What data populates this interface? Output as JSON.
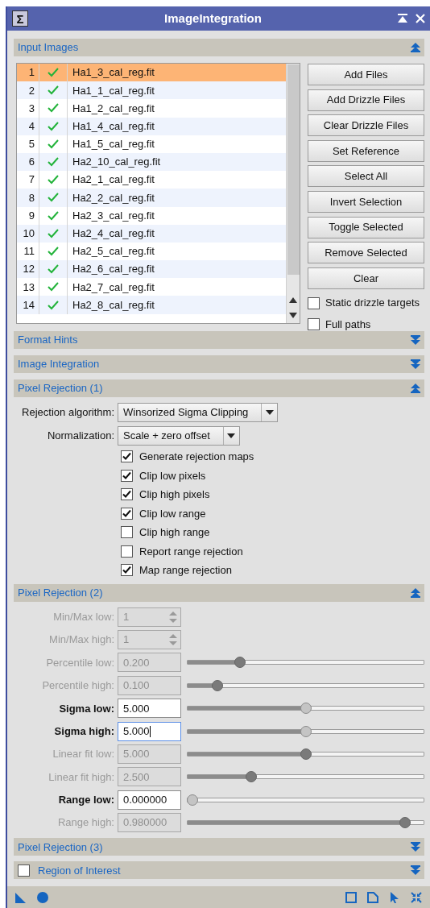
{
  "window": {
    "icon_glyph": "Σ",
    "title": "ImageIntegration"
  },
  "input_images": {
    "header": {
      "label": "Input Images",
      "expanded": true
    },
    "rows": [
      {
        "index": "1",
        "enabled": true,
        "name": "Ha1_3_cal_reg.fit",
        "selected": true
      },
      {
        "index": "2",
        "enabled": true,
        "name": "Ha1_1_cal_reg.fit",
        "selected": false
      },
      {
        "index": "3",
        "enabled": true,
        "name": "Ha1_2_cal_reg.fit",
        "selected": false
      },
      {
        "index": "4",
        "enabled": true,
        "name": "Ha1_4_cal_reg.fit",
        "selected": false
      },
      {
        "index": "5",
        "enabled": true,
        "name": "Ha1_5_cal_reg.fit",
        "selected": false
      },
      {
        "index": "6",
        "enabled": true,
        "name": "Ha2_10_cal_reg.fit",
        "selected": false
      },
      {
        "index": "7",
        "enabled": true,
        "name": "Ha2_1_cal_reg.fit",
        "selected": false
      },
      {
        "index": "8",
        "enabled": true,
        "name": "Ha2_2_cal_reg.fit",
        "selected": false
      },
      {
        "index": "9",
        "enabled": true,
        "name": "Ha2_3_cal_reg.fit",
        "selected": false
      },
      {
        "index": "10",
        "enabled": true,
        "name": "Ha2_4_cal_reg.fit",
        "selected": false
      },
      {
        "index": "11",
        "enabled": true,
        "name": "Ha2_5_cal_reg.fit",
        "selected": false
      },
      {
        "index": "12",
        "enabled": true,
        "name": "Ha2_6_cal_reg.fit",
        "selected": false
      },
      {
        "index": "13",
        "enabled": true,
        "name": "Ha2_7_cal_reg.fit",
        "selected": false
      },
      {
        "index": "14",
        "enabled": true,
        "name": "Ha2_8_cal_reg.fit",
        "selected": false
      }
    ],
    "buttons": [
      "Add Files",
      "Add Drizzle Files",
      "Clear Drizzle Files",
      "Set Reference",
      "Select All",
      "Invert Selection",
      "Toggle Selected",
      "Remove Selected",
      "Clear"
    ],
    "options": [
      {
        "label": "Static drizzle targets",
        "checked": false
      },
      {
        "label": "Full paths",
        "checked": false
      }
    ]
  },
  "format_hints": {
    "label": "Format Hints",
    "expanded": false
  },
  "image_integration": {
    "label": "Image Integration",
    "expanded": false
  },
  "pixel_rejection_1": {
    "label": "Pixel Rejection (1)",
    "expanded": true,
    "combos": [
      {
        "label": "Rejection algorithm:",
        "value": "Winsorized Sigma Clipping"
      },
      {
        "label": "Normalization:",
        "value": "Scale + zero offset"
      }
    ],
    "checkboxes": [
      {
        "label": "Generate rejection maps",
        "checked": true
      },
      {
        "label": "Clip low pixels",
        "checked": true
      },
      {
        "label": "Clip high pixels",
        "checked": true
      },
      {
        "label": "Clip low range",
        "checked": true
      },
      {
        "label": "Clip high range",
        "checked": false
      },
      {
        "label": "Report range rejection",
        "checked": false
      },
      {
        "label": "Map range rejection",
        "checked": true
      }
    ]
  },
  "pixel_rejection_2": {
    "label": "Pixel Rejection (2)",
    "expanded": true,
    "rows": [
      {
        "kind": "spin",
        "label": "Min/Max low:",
        "value": "1",
        "disabled": true,
        "focused": false
      },
      {
        "kind": "spin",
        "label": "Min/Max high:",
        "value": "1",
        "disabled": true,
        "focused": false
      },
      {
        "kind": "slider",
        "label": "Percentile low:",
        "value": "0.200",
        "disabled": true,
        "focused": false,
        "level": 0.21
      },
      {
        "kind": "slider",
        "label": "Percentile high:",
        "value": "0.100",
        "disabled": true,
        "focused": false,
        "level": 0.11
      },
      {
        "kind": "slider",
        "label": "Sigma low:",
        "value": "5.000",
        "disabled": false,
        "focused": false,
        "level": 0.5
      },
      {
        "kind": "slider",
        "label": "Sigma high:",
        "value": "5.000",
        "disabled": false,
        "focused": true,
        "level": 0.5
      },
      {
        "kind": "slider",
        "label": "Linear fit low:",
        "value": "5.000",
        "disabled": true,
        "focused": false,
        "level": 0.5
      },
      {
        "kind": "slider",
        "label": "Linear fit high:",
        "value": "2.500",
        "disabled": true,
        "focused": false,
        "level": 0.26
      },
      {
        "kind": "slider",
        "label": "Range low:",
        "value": "0.000000",
        "disabled": false,
        "focused": false,
        "level": 0.0
      },
      {
        "kind": "slider",
        "label": "Range high:",
        "value": "0.980000",
        "disabled": true,
        "focused": false,
        "level": 0.94
      }
    ]
  },
  "pixel_rejection_3": {
    "label": "Pixel Rejection (3)",
    "expanded": false
  },
  "region_of_interest": {
    "label": "Region of Interest",
    "expanded": false,
    "checked": false
  }
}
